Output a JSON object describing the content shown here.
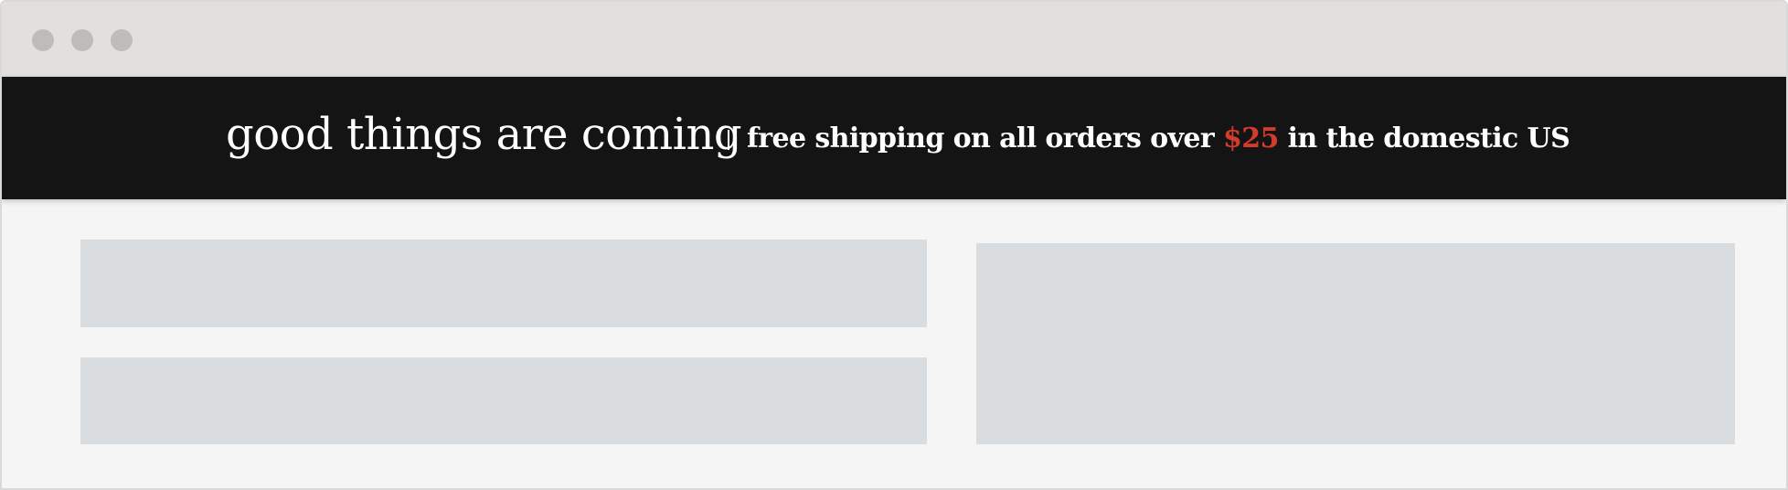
{
  "banner": {
    "tagline": "good things are coming",
    "separator": "|",
    "promo_prefix": "free shipping on all orders over ",
    "promo_price": "$25",
    "promo_suffix": " in the domestic US"
  },
  "colors": {
    "titlebar": "#e1e0de",
    "window_controls": "#bdbcba",
    "banner_background": "#141414",
    "banner_text": "#ffffff",
    "price_accent": "#d63a2b",
    "page_background": "#f5f5f5",
    "content_placeholder": "#d9dde0"
  },
  "window_controls": [
    "close-dot",
    "minimize-dot",
    "maximize-dot"
  ]
}
